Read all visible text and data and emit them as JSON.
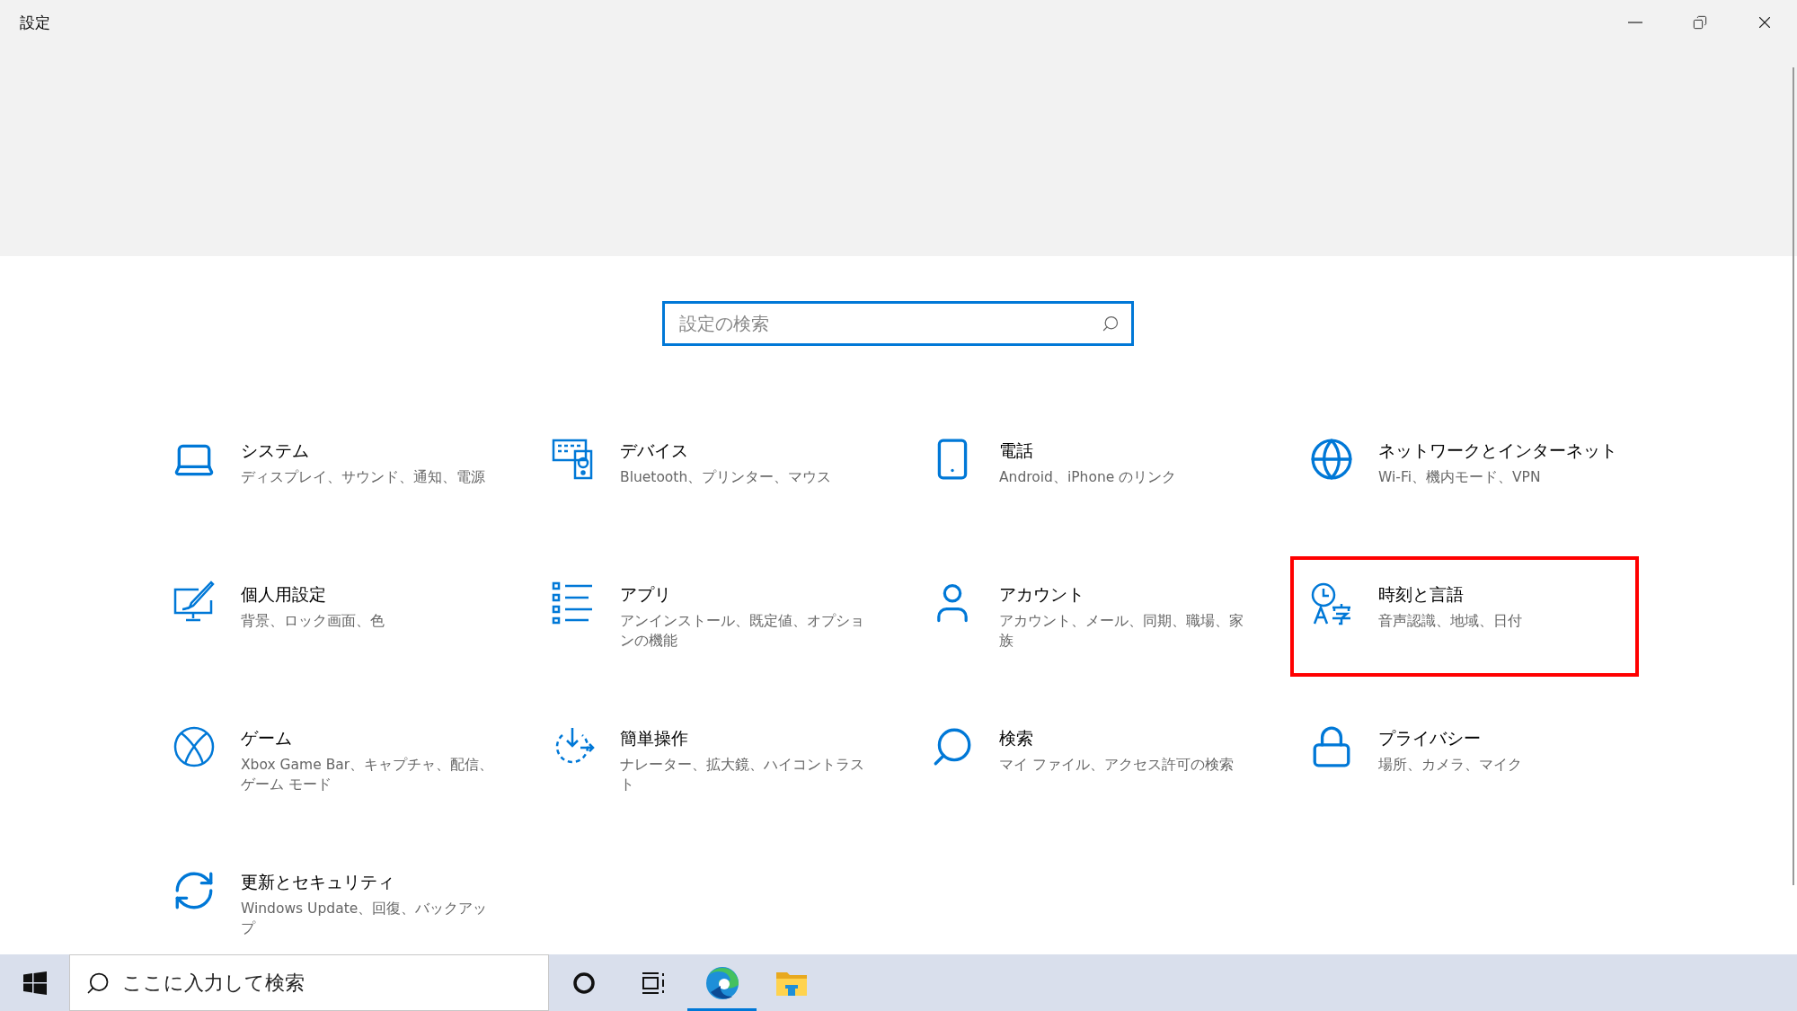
{
  "window": {
    "title": "設定"
  },
  "search": {
    "placeholder": "設定の検索"
  },
  "categories": [
    {
      "kind": "system",
      "title": "システム",
      "description": "ディスプレイ、サウンド、通知、電源",
      "highlighted": false
    },
    {
      "kind": "devices",
      "title": "デバイス",
      "description": "Bluetooth、プリンター、マウス",
      "highlighted": false
    },
    {
      "kind": "phone",
      "title": "電話",
      "description": "Android、iPhone のリンク",
      "highlighted": false
    },
    {
      "kind": "network",
      "title": "ネットワークとインターネット",
      "description": "Wi-Fi、機内モード、VPN",
      "highlighted": false
    },
    {
      "kind": "personalization",
      "title": "個人用設定",
      "description": "背景、ロック画面、色",
      "highlighted": false
    },
    {
      "kind": "apps",
      "title": "アプリ",
      "description": "アンインストール、既定値、オプションの機能",
      "highlighted": false
    },
    {
      "kind": "accounts",
      "title": "アカウント",
      "description": "アカウント、メール、同期、職場、家族",
      "highlighted": false
    },
    {
      "kind": "time",
      "title": "時刻と言語",
      "description": "音声認識、地域、日付",
      "highlighted": true
    },
    {
      "kind": "gaming",
      "title": "ゲーム",
      "description": "Xbox Game Bar、キャプチャ、配信、ゲーム モード",
      "highlighted": false
    },
    {
      "kind": "ease",
      "title": "簡単操作",
      "description": "ナレーター、拡大鏡、ハイコントラスト",
      "highlighted": false
    },
    {
      "kind": "search",
      "title": "検索",
      "description": "マイ ファイル、アクセス許可の検索",
      "highlighted": false
    },
    {
      "kind": "privacy",
      "title": "プライバシー",
      "description": "場所、カメラ、マイク",
      "highlighted": false
    },
    {
      "kind": "update",
      "title": "更新とセキュリティ",
      "description": "Windows Update、回復、バックアップ",
      "highlighted": false
    }
  ],
  "taskbar": {
    "search_placeholder": "ここに入力して検索",
    "apps": [
      {
        "kind": "cortana",
        "active": false
      },
      {
        "kind": "taskview",
        "active": false
      },
      {
        "kind": "edge",
        "active": true
      },
      {
        "kind": "explorer",
        "active": false
      }
    ]
  }
}
